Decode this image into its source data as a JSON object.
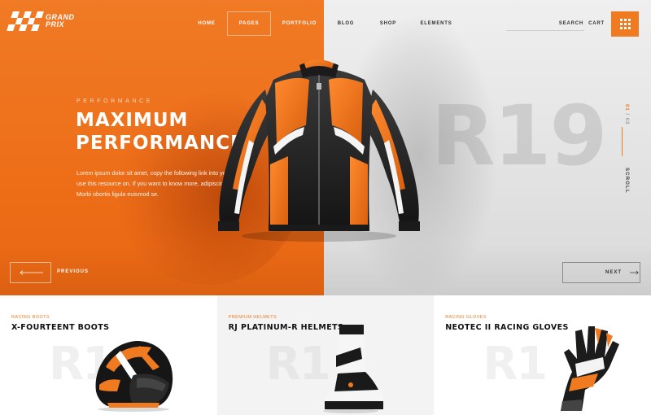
{
  "brand": {
    "line1": "GRAND",
    "line2": "PRIX"
  },
  "nav": {
    "items": [
      {
        "label": "HOME"
      },
      {
        "label": "PAGES"
      },
      {
        "label": "PORTFOLIO"
      },
      {
        "label": "BLOG"
      },
      {
        "label": "SHOP"
      },
      {
        "label": "ELEMENTS"
      }
    ],
    "search": "SEARCH",
    "cart": "CART",
    "active": "PAGES"
  },
  "hero": {
    "eyebrow": "PERFORMANCE",
    "title": "MAXIMUM PERFORMANCE",
    "description": "Lorem ipsum dolor sit amet, copy the following link into you'll use this resource on. If you want to know more, adipiscing elit. Morbi obortis ligula euismod se.",
    "background_number": "R19",
    "slide_number": "01",
    "slide_total": "03",
    "scroll_label": "SCROLL",
    "prev_label": "PREVIOUS",
    "next_label": "NEXT"
  },
  "products": [
    {
      "category": "RACING BOOTS",
      "name": "X-FOURTEENT BOOTS",
      "bg_text": "R1"
    },
    {
      "category": "PREMIUM HELMETS",
      "name": "RJ PLATINUM-R HELMETS",
      "bg_text": "R1"
    },
    {
      "category": "RACING GLOVES",
      "name": "NEOTEC II RACING GLOVES",
      "bg_text": "R1"
    }
  ],
  "colors": {
    "accent": "#ef7a20",
    "dark": "#1a1a1a",
    "light_grey": "#e6e6e6"
  }
}
